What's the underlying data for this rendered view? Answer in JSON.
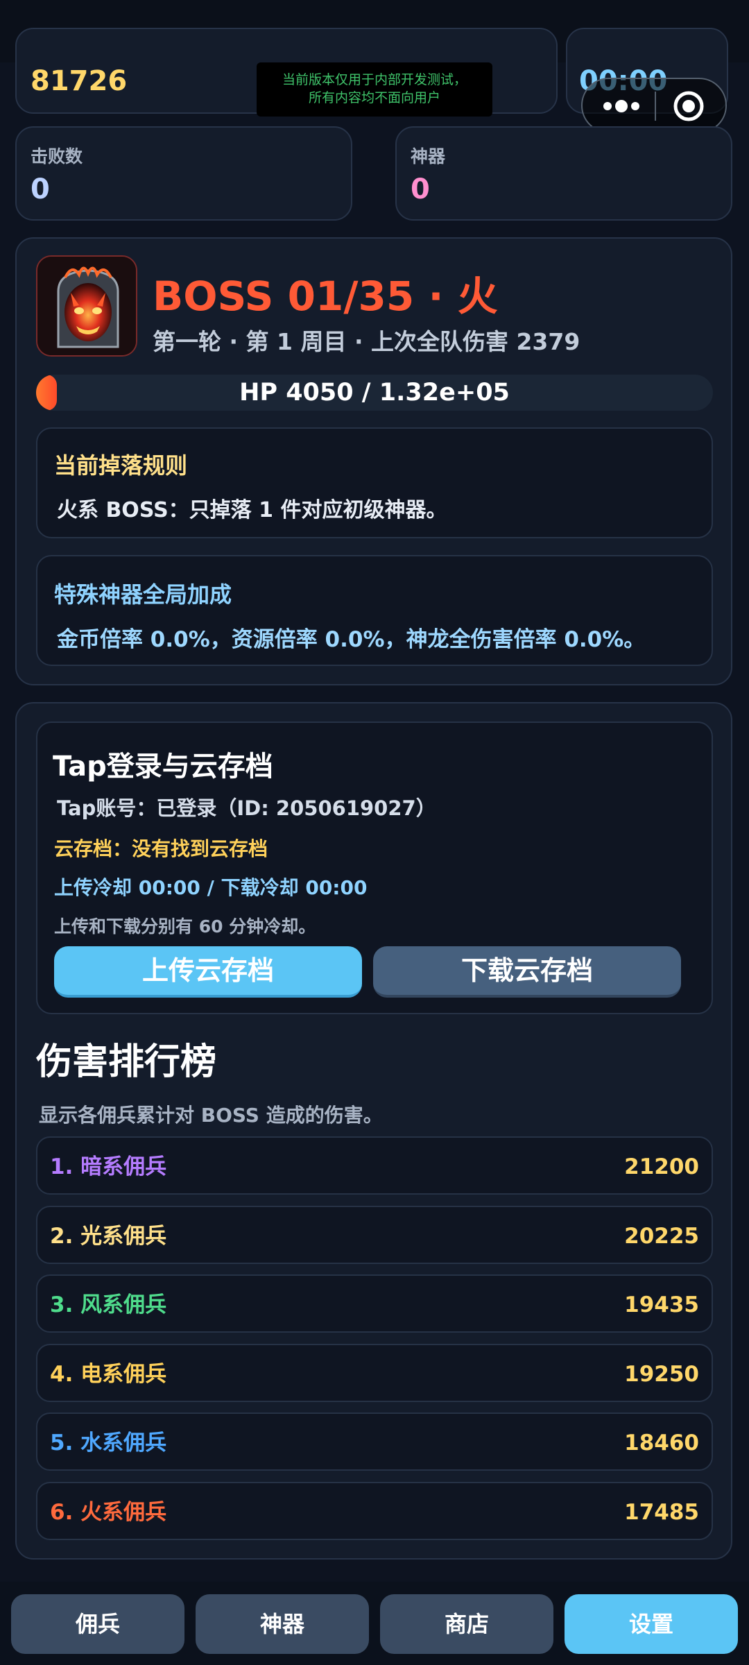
{
  "top": {
    "score": "81726",
    "timer": "00:00"
  },
  "notice": {
    "line1": "当前版本仅用于内部开发测试，",
    "line2": "所有内容均不面向用户"
  },
  "stats": [
    {
      "label": "击败数",
      "value": "0"
    },
    {
      "label": "神器",
      "value": "0"
    }
  ],
  "boss": {
    "title": "BOSS 01/35 · 火",
    "subtitle": "第一轮 · 第 1 周目 · 上次全队伤害 2379",
    "hp_text": "HP 4050 / 1.32e+05",
    "hp_fraction": 0.031
  },
  "drop_rule": {
    "title": "当前掉落规则",
    "text": "火系 BOSS：只掉落 1 件对应初级神器。"
  },
  "bonus": {
    "title": "特殊神器全局加成",
    "text": "金币倍率 0.0%，资源倍率 0.0%，神龙全伤害倍率 0.0%。"
  },
  "cloud": {
    "title": "Tap登录与云存档",
    "account": "Tap账号：已登录（ID: 2050619027）",
    "save_status": "云存档：没有找到云存档",
    "cooldown": "上传冷却 00:00 / 下载冷却 00:00",
    "note": "上传和下载分别有 60 分钟冷却。",
    "upload_label": "上传云存档",
    "download_label": "下载云存档"
  },
  "ranking": {
    "title": "伤害排行榜",
    "subtitle": "显示各佣兵累计对 BOSS 造成的伤害。",
    "rows": [
      {
        "name": "1. 暗系佣兵",
        "value": "21200",
        "color": "#b57cff"
      },
      {
        "name": "2. 光系佣兵",
        "value": "20225",
        "color": "#ffe08a"
      },
      {
        "name": "3. 风系佣兵",
        "value": "19435",
        "color": "#4fdc8c"
      },
      {
        "name": "4. 电系佣兵",
        "value": "19250",
        "color": "#ffd15a"
      },
      {
        "name": "5. 水系佣兵",
        "value": "18460",
        "color": "#4fa8ff"
      },
      {
        "name": "6. 火系佣兵",
        "value": "17485",
        "color": "#ff6a3d"
      }
    ]
  },
  "nav": {
    "tab1": "佣兵",
    "tab2": "神器",
    "tab3": "商店",
    "tab4": "设置",
    "active": "设置"
  },
  "colors": {
    "accent": "#5bc5f5",
    "boss_red": "#ff5a36",
    "gold": "#ffd76a"
  },
  "icons": {
    "capsule_menu": "more-dots-icon",
    "capsule_close": "target-circle-icon"
  }
}
